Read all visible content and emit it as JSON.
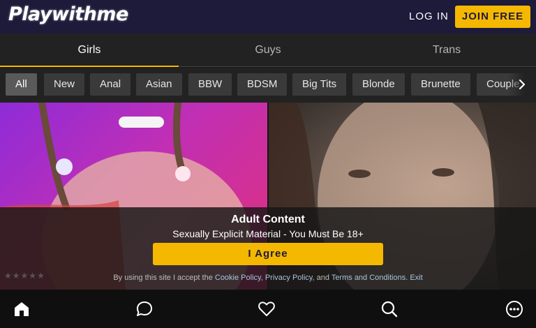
{
  "header": {
    "logo": "Playwithme",
    "login_label": "LOG IN",
    "join_label": "JOIN FREE",
    "accent": "#f5b800",
    "bg": "#1d1a3a"
  },
  "tabs": [
    {
      "label": "Girls",
      "active": true
    },
    {
      "label": "Guys",
      "active": false
    },
    {
      "label": "Trans",
      "active": false
    }
  ],
  "filters": [
    "All",
    "New",
    "Anal",
    "Asian",
    "BBW",
    "BDSM",
    "Big Tits",
    "Blonde",
    "Brunette",
    "Couple"
  ],
  "filters_active": "All",
  "filters_arrow_icon": "chevron-right-icon",
  "thumbnails": [
    {
      "alt": "model-photo"
    },
    {
      "alt": "model-photo"
    }
  ],
  "overlay": {
    "title": "Adult Content",
    "subtitle": "Sexually Explicit Material - You Must Be 18+",
    "agree_label": "I Agree",
    "legal_prefix": "By using this site I accept the",
    "cookie_policy": "Cookie Policy",
    "comma": ",",
    "privacy_policy": "Privacy Policy",
    "and": ", and",
    "terms": "Terms and Conditions",
    "exit": ". Exit"
  },
  "rating_stars": "★★★★★",
  "bottom_nav": [
    "home-icon",
    "chat-icon",
    "heart-icon",
    "search-icon",
    "more-icon"
  ]
}
